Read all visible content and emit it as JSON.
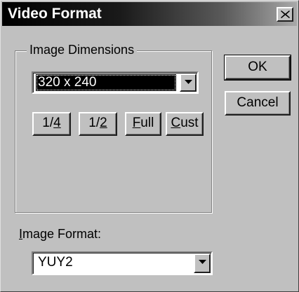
{
  "window": {
    "title": "Video Format",
    "close_glyph": "close-icon"
  },
  "image_dimensions": {
    "group_label": "Image Dimensions",
    "selected_size": "320 x 240",
    "presets": [
      {
        "text": "1/4",
        "mnemonic": "4"
      },
      {
        "text": "1/2",
        "mnemonic": "2"
      },
      {
        "text": "Full",
        "mnemonic": "F"
      },
      {
        "text": "Cust",
        "mnemonic": "C"
      }
    ]
  },
  "image_format": {
    "label": "Image Format:",
    "mnemonic": "I",
    "value": "YUY2"
  },
  "actions": {
    "ok_label": "OK",
    "cancel_label": "Cancel"
  },
  "icons": {
    "close": "close-icon",
    "dropdown": "chevron-down-icon"
  },
  "colors": {
    "dialog_face": "#c0c0c0",
    "title_start": "#000000",
    "title_end": "#a8a8a8",
    "selection_bg": "#000000",
    "selection_text": "#ffffff"
  }
}
